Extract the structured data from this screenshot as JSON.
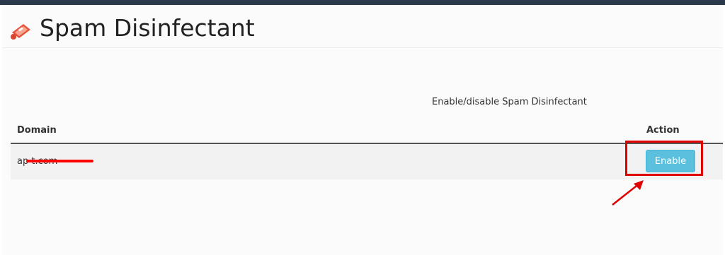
{
  "page": {
    "title": "Spam Disinfectant",
    "icon": "spam-disinfectant-icon"
  },
  "section": {
    "subtitle": "Enable/disable Spam Disinfectant"
  },
  "table": {
    "headers": {
      "domain": "Domain",
      "action": "Action"
    },
    "rows": [
      {
        "domain": "ap                    t.com",
        "action_label": "Enable"
      }
    ]
  },
  "colors": {
    "topbar": "#2a3a4b",
    "button": "#5bc0de",
    "annotation": "#e00000",
    "redaction": "#ff0000"
  }
}
